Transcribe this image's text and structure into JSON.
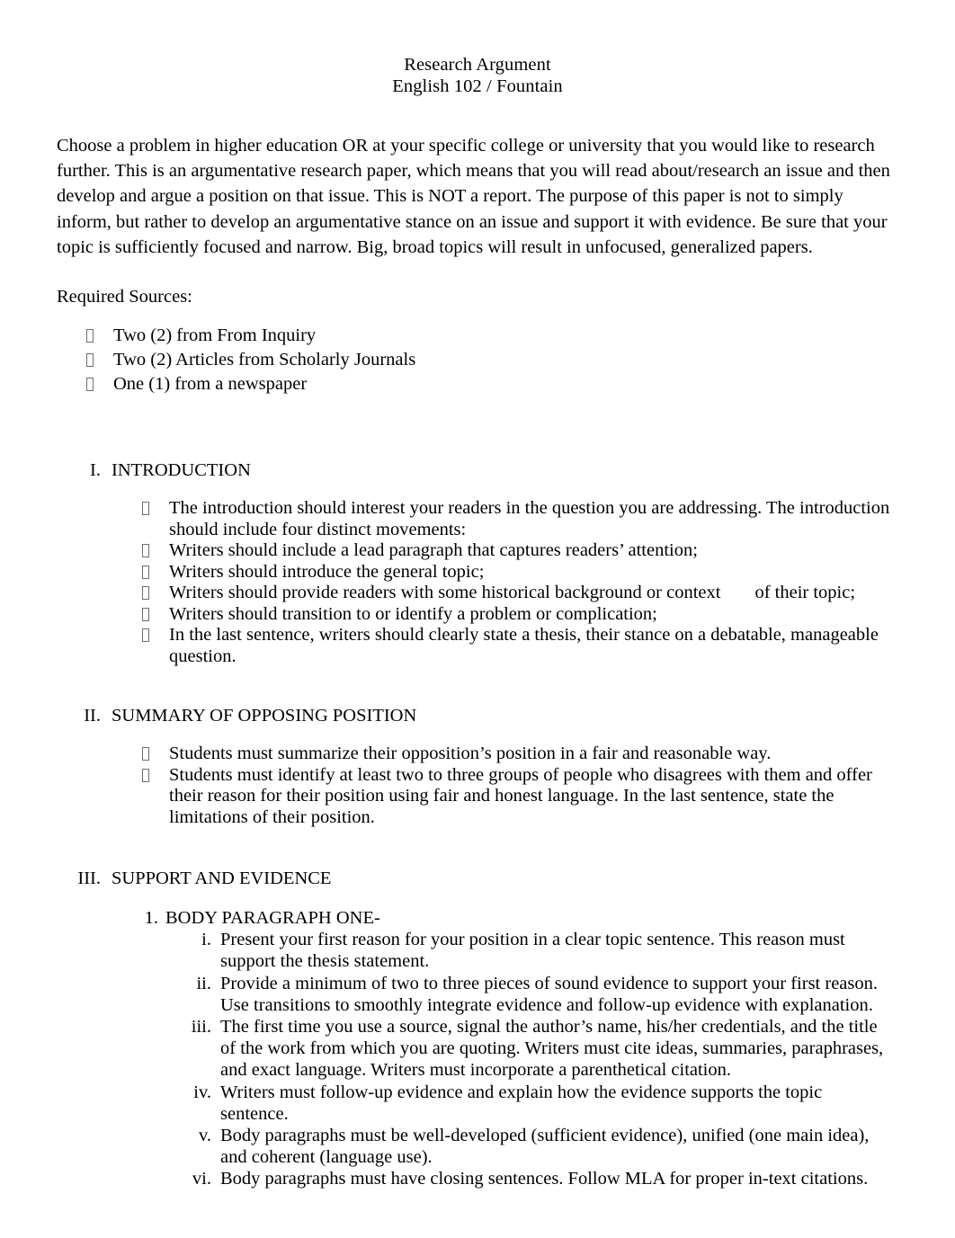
{
  "document": {
    "header": {
      "line1": "Research Argument",
      "line2": "English 102 / Fountain"
    },
    "intro_paragraph": "Choose a problem in higher education OR at your specific college or university that you would like to research further. This is an argumentative research paper, which means that you will read about/research an issue and then develop and argue a position on that issue. This is NOT a report. The purpose of this paper is not to simply inform, but rather to develop an argumentative stance on an issue and support it with evidence. Be sure that your topic is sufficiently focused and narrow.   Big, broad topics will result in unfocused, generalized papers.",
    "required_sources": {
      "label": "Required Sources:",
      "items": [
        "Two (2) from From Inquiry",
        "Two (2) Articles from Scholarly Journals",
        "One (1) from a newspaper"
      ]
    },
    "sections": [
      {
        "numeral": "I.",
        "title": "INTRODUCTION",
        "bullets": [
          "The introduction should interest your readers in the question you are addressing.  The introduction should include four distinct movements:",
          "Writers should include a lead paragraph that captures readers’ attention;",
          "Writers should introduce the general topic;",
          "Writers should provide readers with some historical background or context",
          "Writers should transition to or identify a problem or complication;",
          "In the last sentence, writers should clearly state a thesis, their stance on a debatable, manageable question."
        ],
        "bullet_3_tail": "of their topic;"
      },
      {
        "numeral": "II.",
        "title": "SUMMARY OF OPPOSING POSITION",
        "bullets": [
          "Students must summarize their opposition’s position in a fair and reasonable way.",
          "Students must identify at least two to three groups of people who disagrees with them and offer their reason for their position using fair and honest language.  In the last sentence, state the limitations of their position."
        ]
      },
      {
        "numeral": "III.",
        "title": "SUPPORT AND EVIDENCE",
        "numbered_items": [
          {
            "marker": "1.",
            "text": "BODY PARAGRAPH ONE-"
          }
        ],
        "roman_items": [
          {
            "marker": "i.",
            "text": "Present your first reason for your position in a clear topic sentence. This reason must support the thesis statement."
          },
          {
            "marker": "ii.",
            "text": "Provide a minimum of two to three pieces of sound evidence to support your first reason. Use transitions to smoothly integrate evidence and follow-up evidence with explanation."
          },
          {
            "marker": "iii.",
            "text": "The first time you use a source, signal the author’s name, his/her credentials, and the title of the work from which you are quoting.  Writers must cite ideas, summaries, paraphrases, and exact language.  Writers must incorporate a parenthetical citation."
          },
          {
            "marker": "iv.",
            "text": "Writers must follow-up evidence and explain how the evidence supports the topic sentence."
          },
          {
            "marker": "v.",
            "text": "Body paragraphs must be well-developed (sufficient evidence), unified (one main idea), and coherent (language use)."
          },
          {
            "marker": "vi.",
            "text": "Body paragraphs must have closing sentences. Follow MLA for proper in-text citations."
          }
        ]
      }
    ]
  }
}
